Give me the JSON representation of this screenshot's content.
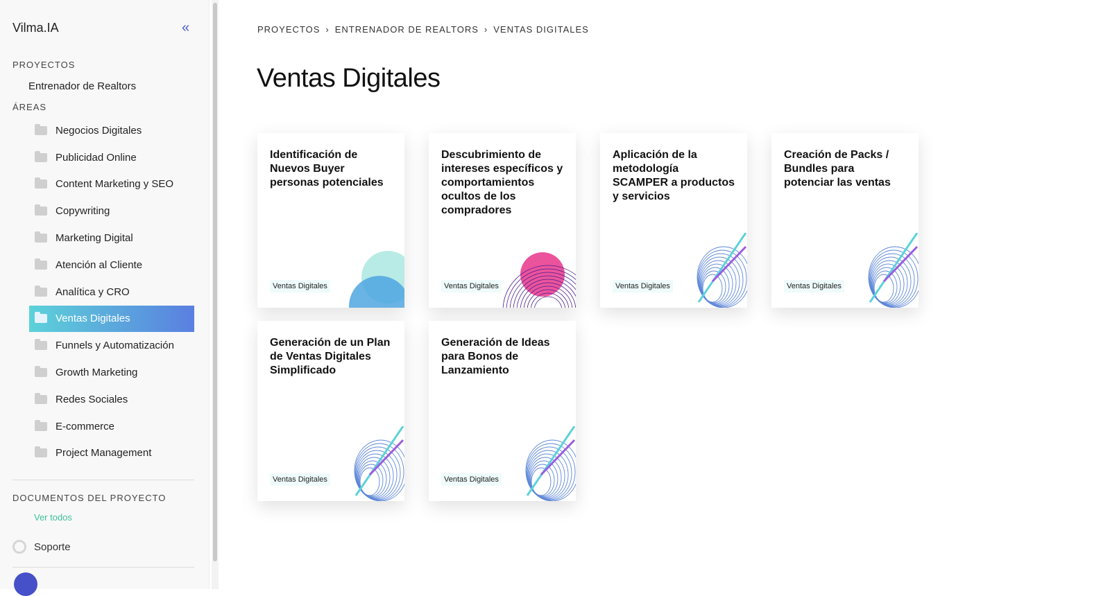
{
  "sidebar": {
    "brand": "Vilma.IA",
    "projects_heading": "PROYECTOS",
    "project": "Entrenador de Realtors",
    "areas_heading": "ÁREAS",
    "areas": [
      {
        "label": "Negocios Digitales"
      },
      {
        "label": "Publicidad Online"
      },
      {
        "label": "Content Marketing y SEO"
      },
      {
        "label": "Copywriting"
      },
      {
        "label": "Marketing Digital"
      },
      {
        "label": "Atención al Cliente"
      },
      {
        "label": "Analítica y CRO"
      },
      {
        "label": "Ventas Digitales",
        "active": true
      },
      {
        "label": "Funnels y Automatización"
      },
      {
        "label": "Growth Marketing"
      },
      {
        "label": "Redes Sociales"
      },
      {
        "label": "E-commerce"
      },
      {
        "label": "Project Management"
      }
    ],
    "docs_heading": "DOCUMENTOS DEL PROYECTO",
    "see_all": "Ver todos",
    "support": "Soporte"
  },
  "breadcrumb": [
    "PROYECTOS",
    "ENTRENADOR DE REALTORS",
    "VENTAS DIGITALES"
  ],
  "title": "Ventas Digitales",
  "cards": [
    {
      "title": "Identificación de Nuevos Buyer personas potenciales",
      "tag": "Ventas Digitales",
      "art": "circles-blue"
    },
    {
      "title": "Descubrimiento de intereses específicos y comportamientos ocultos de los compradores",
      "tag": "Ventas Digitales",
      "art": "circles-pink"
    },
    {
      "title": "Aplicación de la metodología SCAMPER a productos y servicios",
      "tag": "Ventas Digitales",
      "art": "shell-lines"
    },
    {
      "title": "Creación de Packs / Bundles para potenciar las ventas",
      "tag": "Ventas Digitales",
      "art": "shell-lines"
    },
    {
      "title": "Generación de un Plan de Ventas Digitales Simplificado",
      "tag": "Ventas Digitales",
      "art": "shell-lines"
    },
    {
      "title": "Generación de Ideas para Bonos de Lanzamiento",
      "tag": "Ventas Digitales",
      "art": "shell-lines"
    }
  ],
  "colors": {
    "accent": "#4a5bd1",
    "active_gradient_start": "#5cd2d9",
    "active_gradient_end": "#5a7fe0",
    "link": "#3ebf9a"
  }
}
